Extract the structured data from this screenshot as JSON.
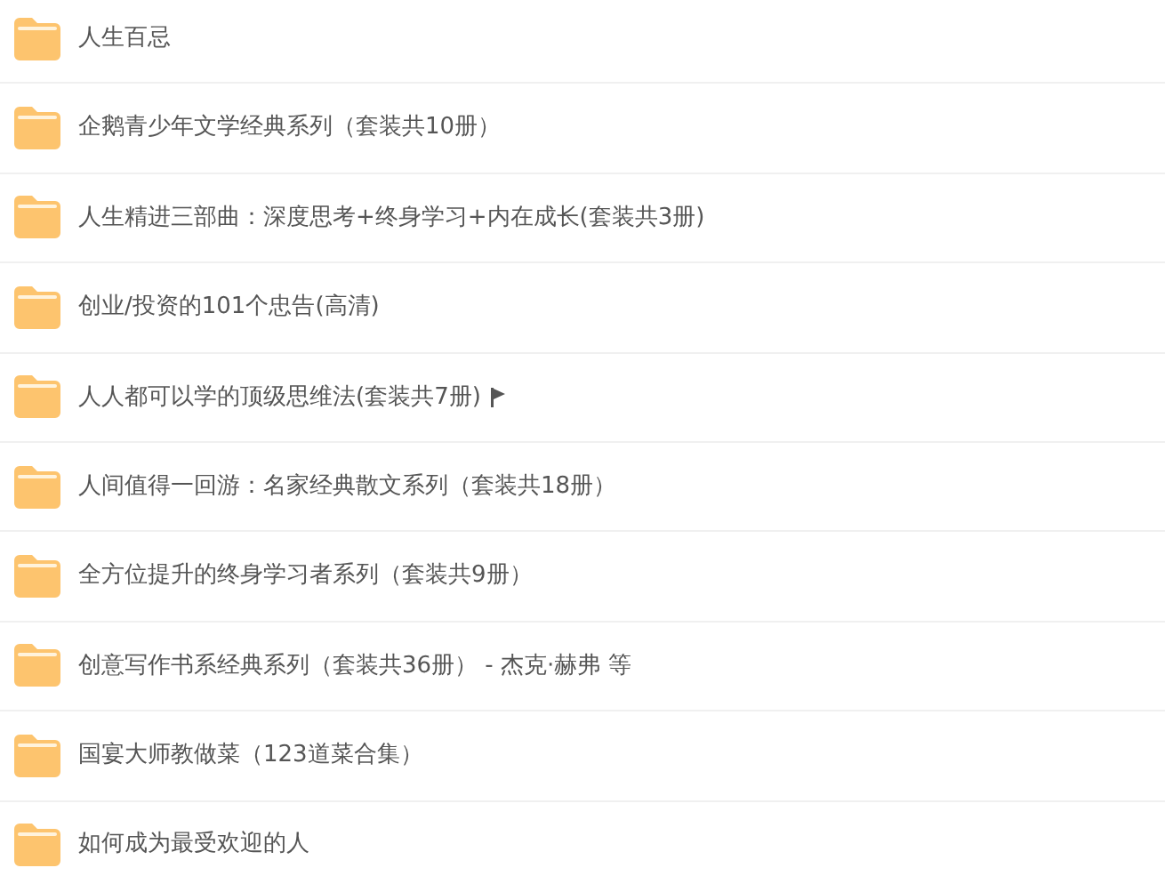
{
  "folders": [
    {
      "name": "人生百忌",
      "flagged": false
    },
    {
      "name": "企鹅青少年文学经典系列（套装共10册）",
      "flagged": false
    },
    {
      "name": "人生精进三部曲：深度思考+终身学习+内在成长(套装共3册)",
      "flagged": false
    },
    {
      "name": "创业/投资的101个忠告(高清)",
      "flagged": false
    },
    {
      "name": "人人都可以学的顶级思维法(套装共7册)",
      "flagged": true
    },
    {
      "name": "人间值得一回游：名家经典散文系列（套装共18册）",
      "flagged": false
    },
    {
      "name": "全方位提升的终身学习者系列（套装共9册）",
      "flagged": false
    },
    {
      "name": "创意写作书系经典系列（套装共36册） - 杰克·赫弗 等",
      "flagged": false
    },
    {
      "name": "国宴大师教做菜（123道菜合集）",
      "flagged": false
    },
    {
      "name": "如何成为最受欢迎的人",
      "flagged": false
    }
  ]
}
